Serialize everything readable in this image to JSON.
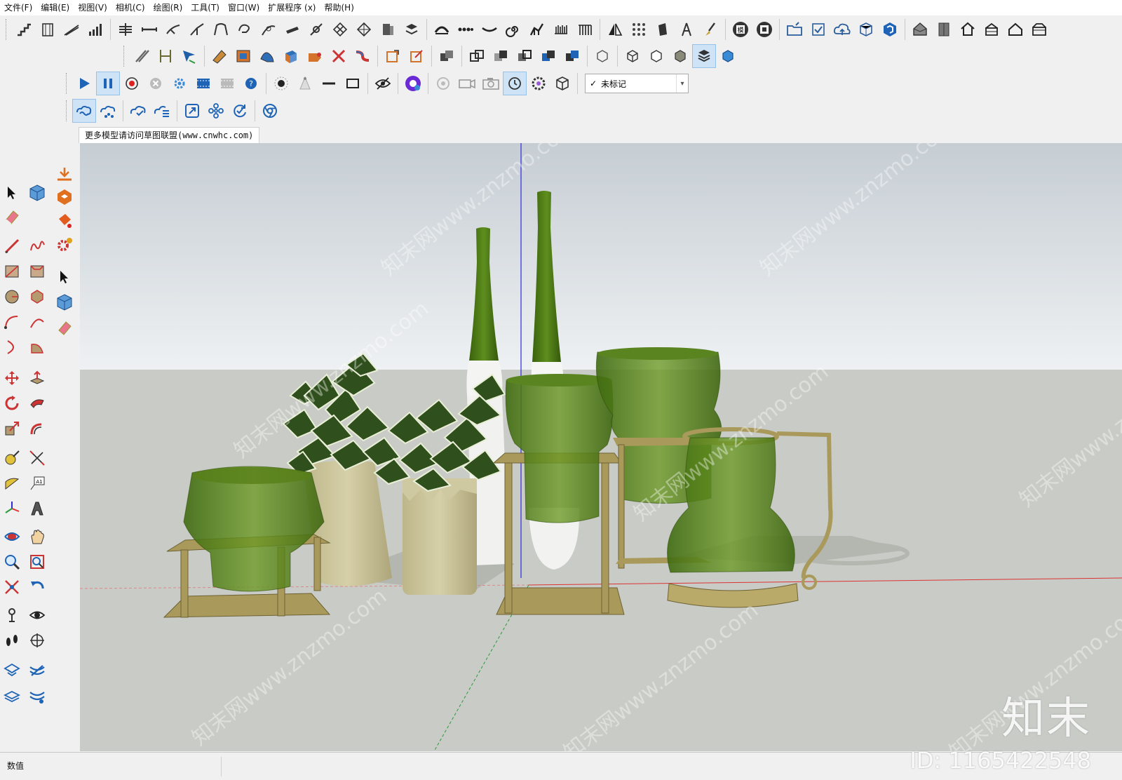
{
  "menu": [
    "文件(F)",
    "编辑(E)",
    "视图(V)",
    "相机(C)",
    "绘图(R)",
    "工具(T)",
    "窗口(W)",
    "扩展程序 (x)",
    "帮助(H)"
  ],
  "toolbar": {
    "tag_selector": {
      "checkmark": "✓",
      "value": "未标记",
      "arrow": "▾"
    }
  },
  "scene_tab": "更多模型请访问草图联盟(www.cnwhc.com)",
  "status": {
    "label": "数值"
  },
  "watermark": {
    "brand": "知末",
    "id": "ID: 1165422548",
    "tile": "知末网www.znzmo.com"
  },
  "colors": {
    "sky_top": "#c7ced3",
    "sky_bottom": "#eef1f3",
    "ground": "#c9cbc6",
    "vase_green": "#4f7a16",
    "stand_gold": "#a99a5b",
    "pot_beige": "#cbc59c",
    "axis_red": "#d33",
    "axis_green": "#2a9a3a",
    "axis_blue": "#2b2bd9"
  }
}
